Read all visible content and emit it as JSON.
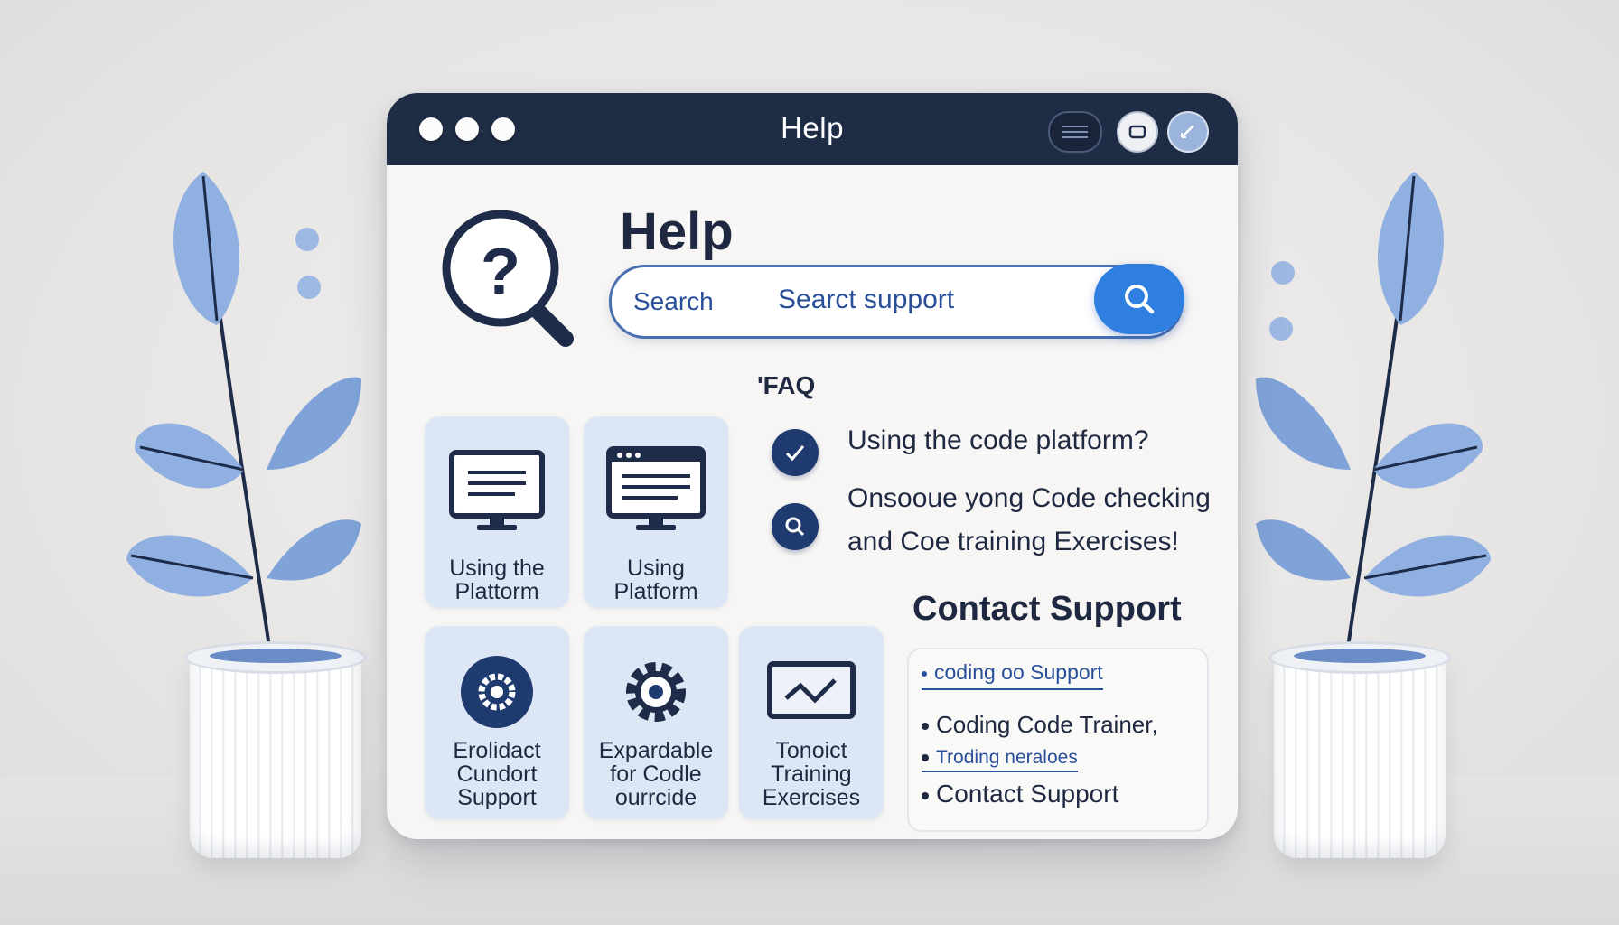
{
  "window": {
    "title": "Help"
  },
  "header": {
    "title": "Help"
  },
  "search": {
    "label": "Search",
    "placeholder": "Searct support"
  },
  "tiles": [
    {
      "label_line1": "Using the",
      "label_line2": "Plattorm",
      "icon": "monitor-icon"
    },
    {
      "label_line1": "Using",
      "label_line2": "Platform",
      "icon": "browser-window-icon"
    },
    {
      "label_line1": "Erolidact",
      "label_line2": "Cundort",
      "label_line3": "Support",
      "icon": "gear-circle-icon"
    },
    {
      "label_line1": "Expardable",
      "label_line2": "for Codle",
      "label_line3": "ourrcide",
      "icon": "gear-icon"
    },
    {
      "label_line1": "Tonoict",
      "label_line2": "Training",
      "label_line3": "Exercises",
      "icon": "chart-screen-icon"
    }
  ],
  "faq": {
    "heading": "'FAQ",
    "items": [
      {
        "icon": "checkmark-icon",
        "text": "Using the code platform?"
      },
      {
        "icon": "search-icon",
        "line1": "Onsooue yong Code checking",
        "line2": "and Coe training Exercises!"
      }
    ]
  },
  "contact": {
    "heading": "Contact Support",
    "items": [
      "coding oo Support",
      "Coding Code Trainer,",
      "Troding neraloes",
      "Contact Support"
    ]
  },
  "colors": {
    "titlebar": "#1f2c45",
    "accent": "#2f7fe0",
    "tile": "#dde6f4",
    "text": "#1e2840"
  }
}
